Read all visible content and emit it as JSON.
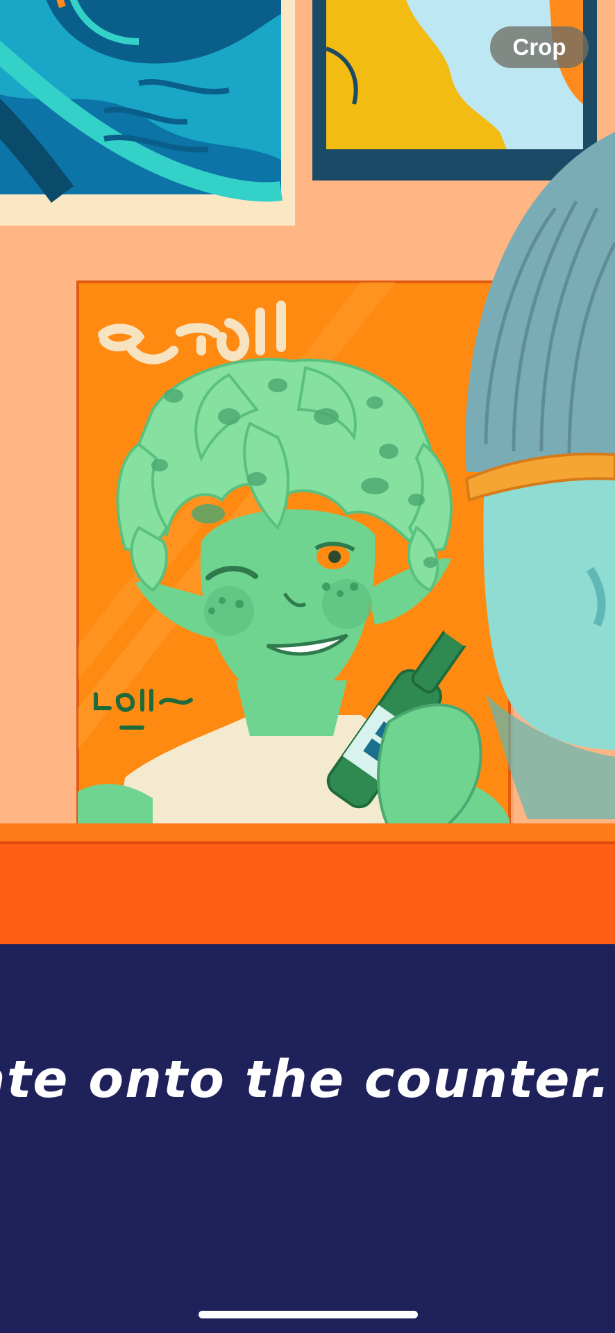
{
  "toolbar": {
    "crop_label": "Crop"
  },
  "dialogue": {
    "text": "ate onto the counter."
  },
  "icons": {
    "poster": "winking-green-character-poster",
    "home": "home-indicator-bar"
  },
  "colors": {
    "wall": "#ffb684",
    "poster_bg": "#ff8a12",
    "counter": "#ff5f14",
    "dialogue_bg": "#1f215a",
    "character": "#6fd48f"
  }
}
